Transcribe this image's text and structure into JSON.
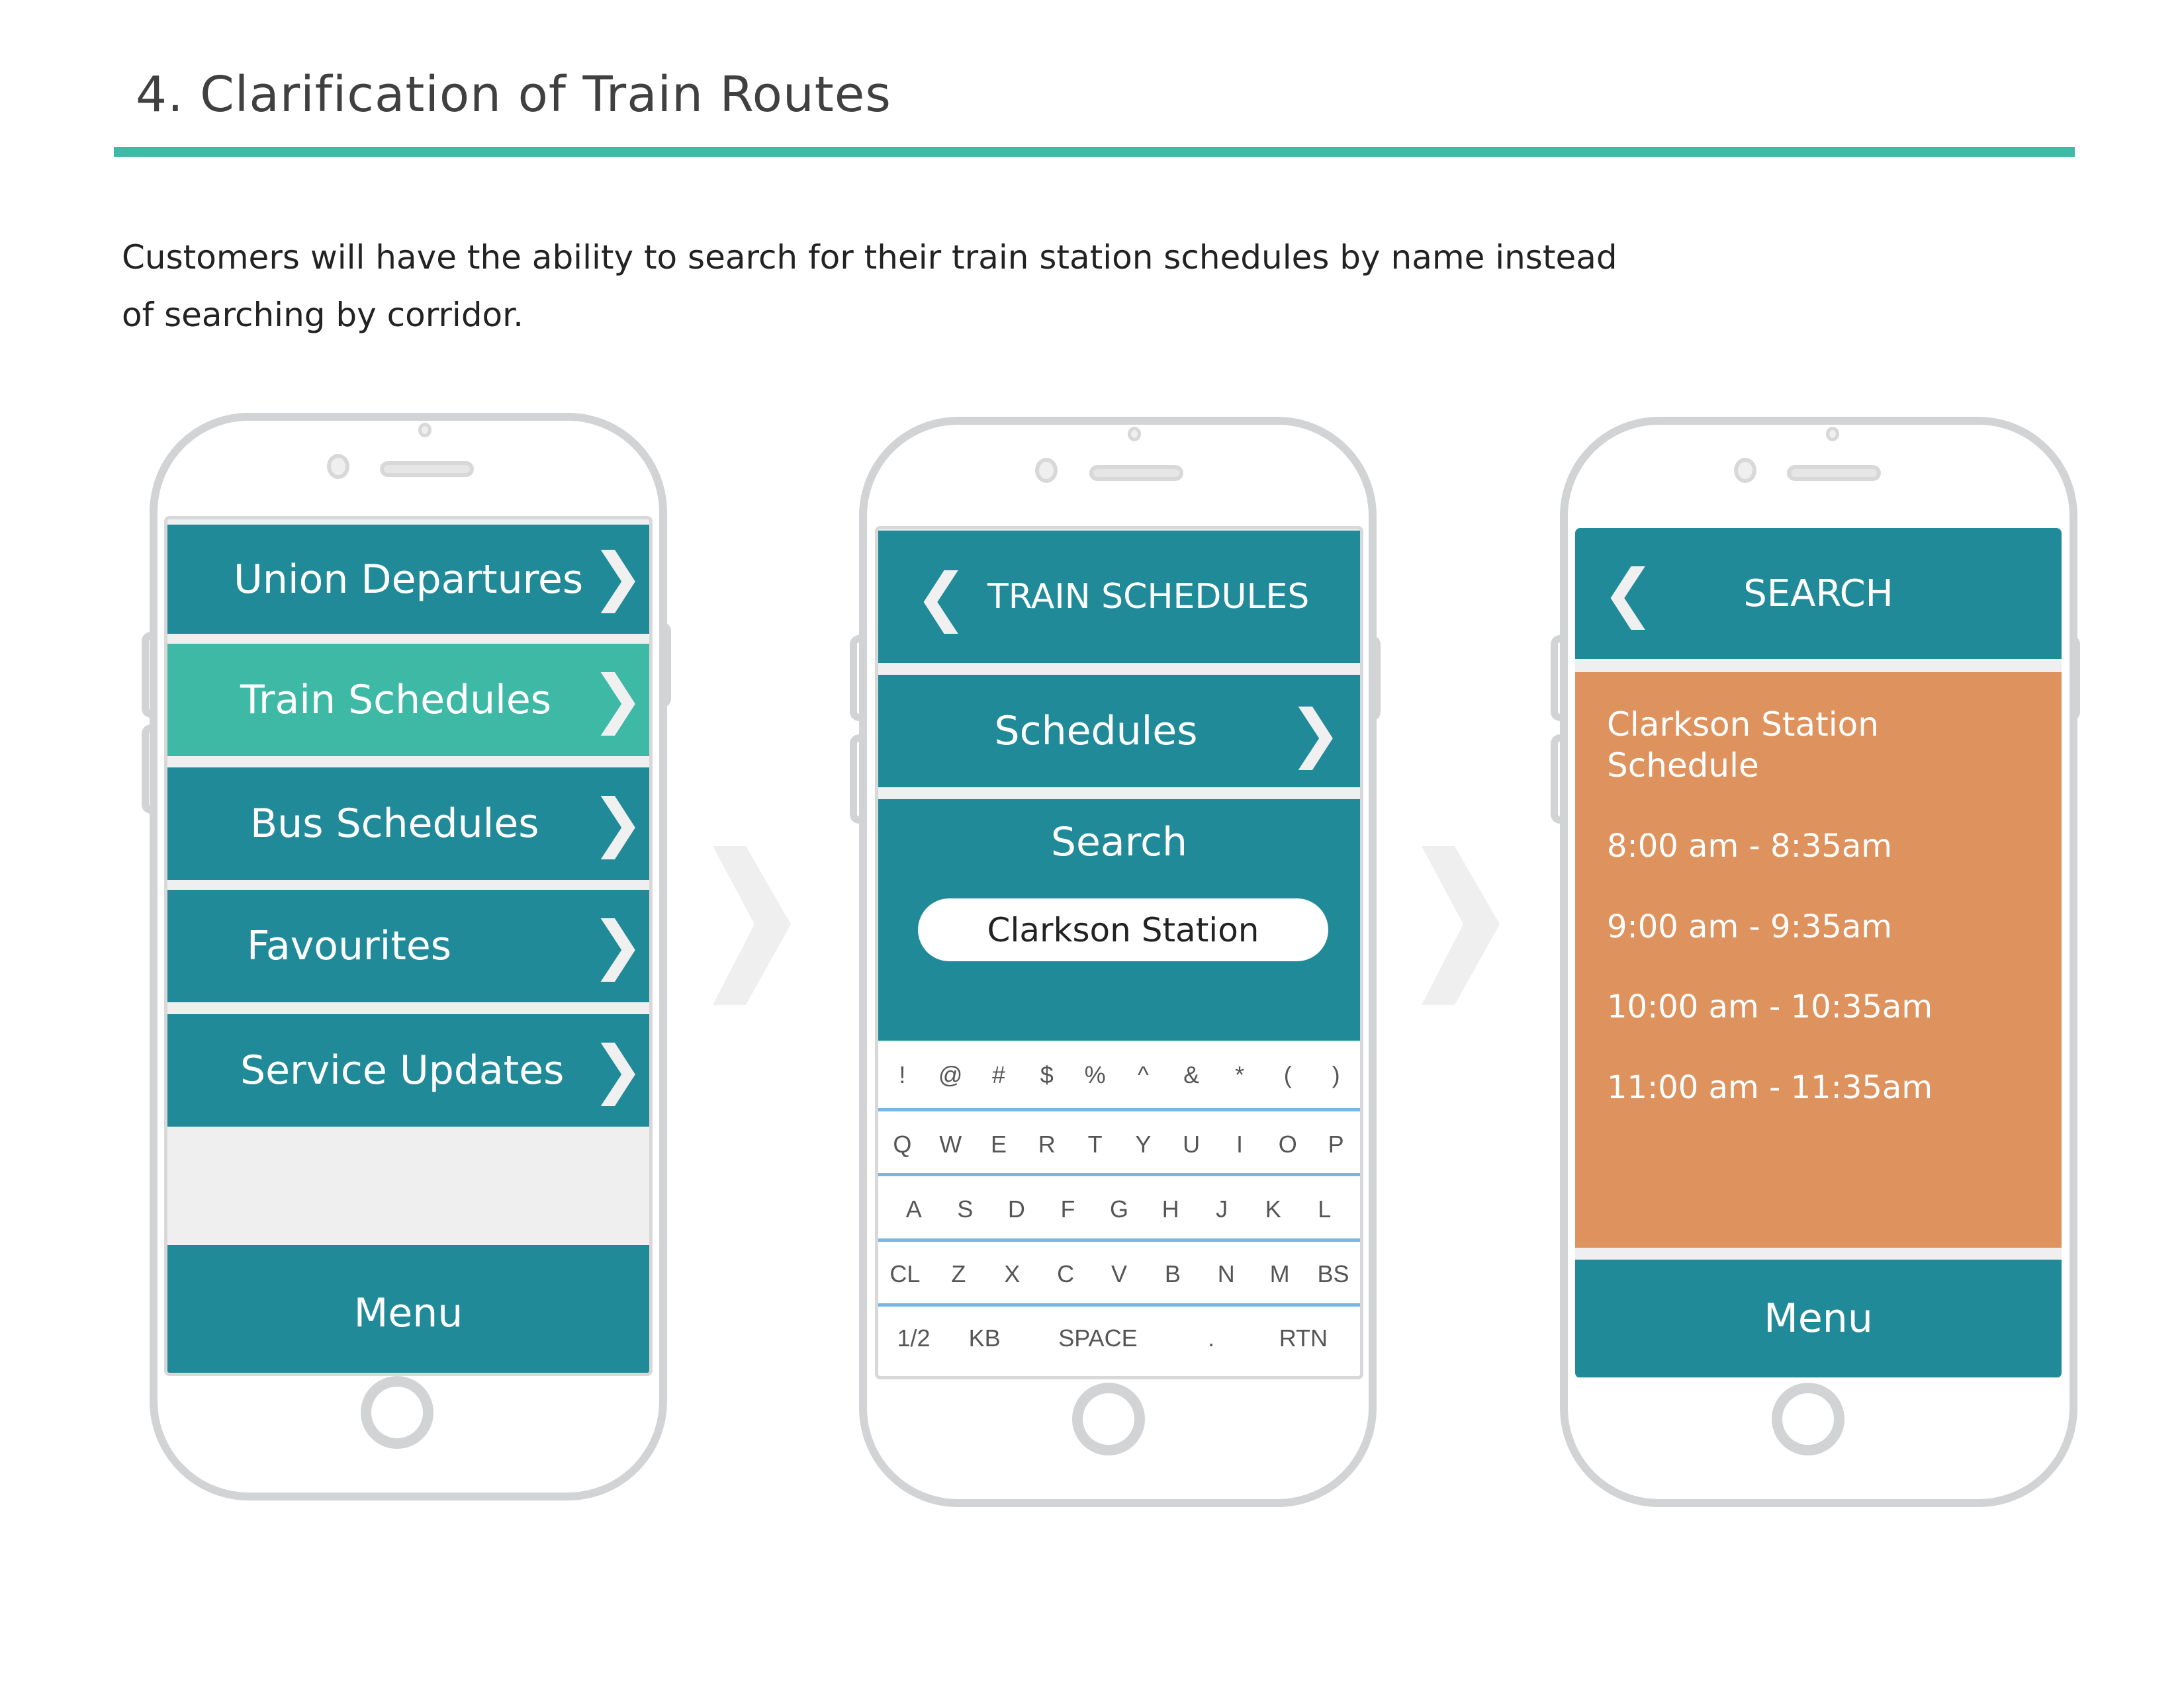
{
  "page": {
    "title": "4. Clarification of Train Routes",
    "description_line1": "Customers will have the ability to search for their train station schedules by name instead",
    "description_line2": "of searching by corridor.",
    "accent_color": "#3db9a5"
  },
  "colors": {
    "primary": "#218a99",
    "active": "#3db9a5",
    "result_bg": "#de925d",
    "frame": "#d2d3d5"
  },
  "screen1": {
    "menu_items": [
      {
        "label": "Union Departures",
        "icon": "chevron-right-icon",
        "active": false
      },
      {
        "label": "Train Schedules",
        "icon": "chevron-right-icon",
        "active": true
      },
      {
        "label": "Bus Schedules",
        "icon": "chevron-right-icon",
        "active": false
      },
      {
        "label": "Favourites",
        "icon": "chevron-right-icon",
        "active": false
      },
      {
        "label": "Service Updates",
        "icon": "chevron-right-icon",
        "active": false
      }
    ],
    "footer_label": "Menu"
  },
  "screen2": {
    "header_title": "TRAIN SCHEDULES",
    "back_icon": "chevron-left-icon",
    "schedules_label": "Schedules",
    "search_label": "Search",
    "search_value": "Clarkson Station",
    "keyboard": {
      "row1": [
        "!",
        "@",
        "#",
        "$",
        "%",
        "^",
        "&",
        "*",
        "(",
        ")"
      ],
      "row2": [
        "Q",
        "W",
        "E",
        "R",
        "T",
        "Y",
        "U",
        "I",
        "O",
        "P"
      ],
      "row3": [
        "A",
        "S",
        "D",
        "F",
        "G",
        "H",
        "J",
        "K",
        "L"
      ],
      "row4": [
        "CL",
        "Z",
        "X",
        "C",
        "V",
        "B",
        "N",
        "M",
        "BS"
      ],
      "row5": [
        "1/2",
        "KB",
        "SPACE",
        ".",
        "RTN"
      ]
    }
  },
  "screen3": {
    "header_title": "SEARCH",
    "back_icon": "chevron-left-icon",
    "result_title_line1": "Clarkson Station",
    "result_title_line2": "Schedule",
    "times": [
      "8:00 am - 8:35am",
      "9:00 am - 9:35am",
      "10:00 am - 10:35am",
      "11:00 am - 11:35am"
    ],
    "footer_label": "Menu"
  },
  "flow_arrow_icon": "chevron-right-icon"
}
